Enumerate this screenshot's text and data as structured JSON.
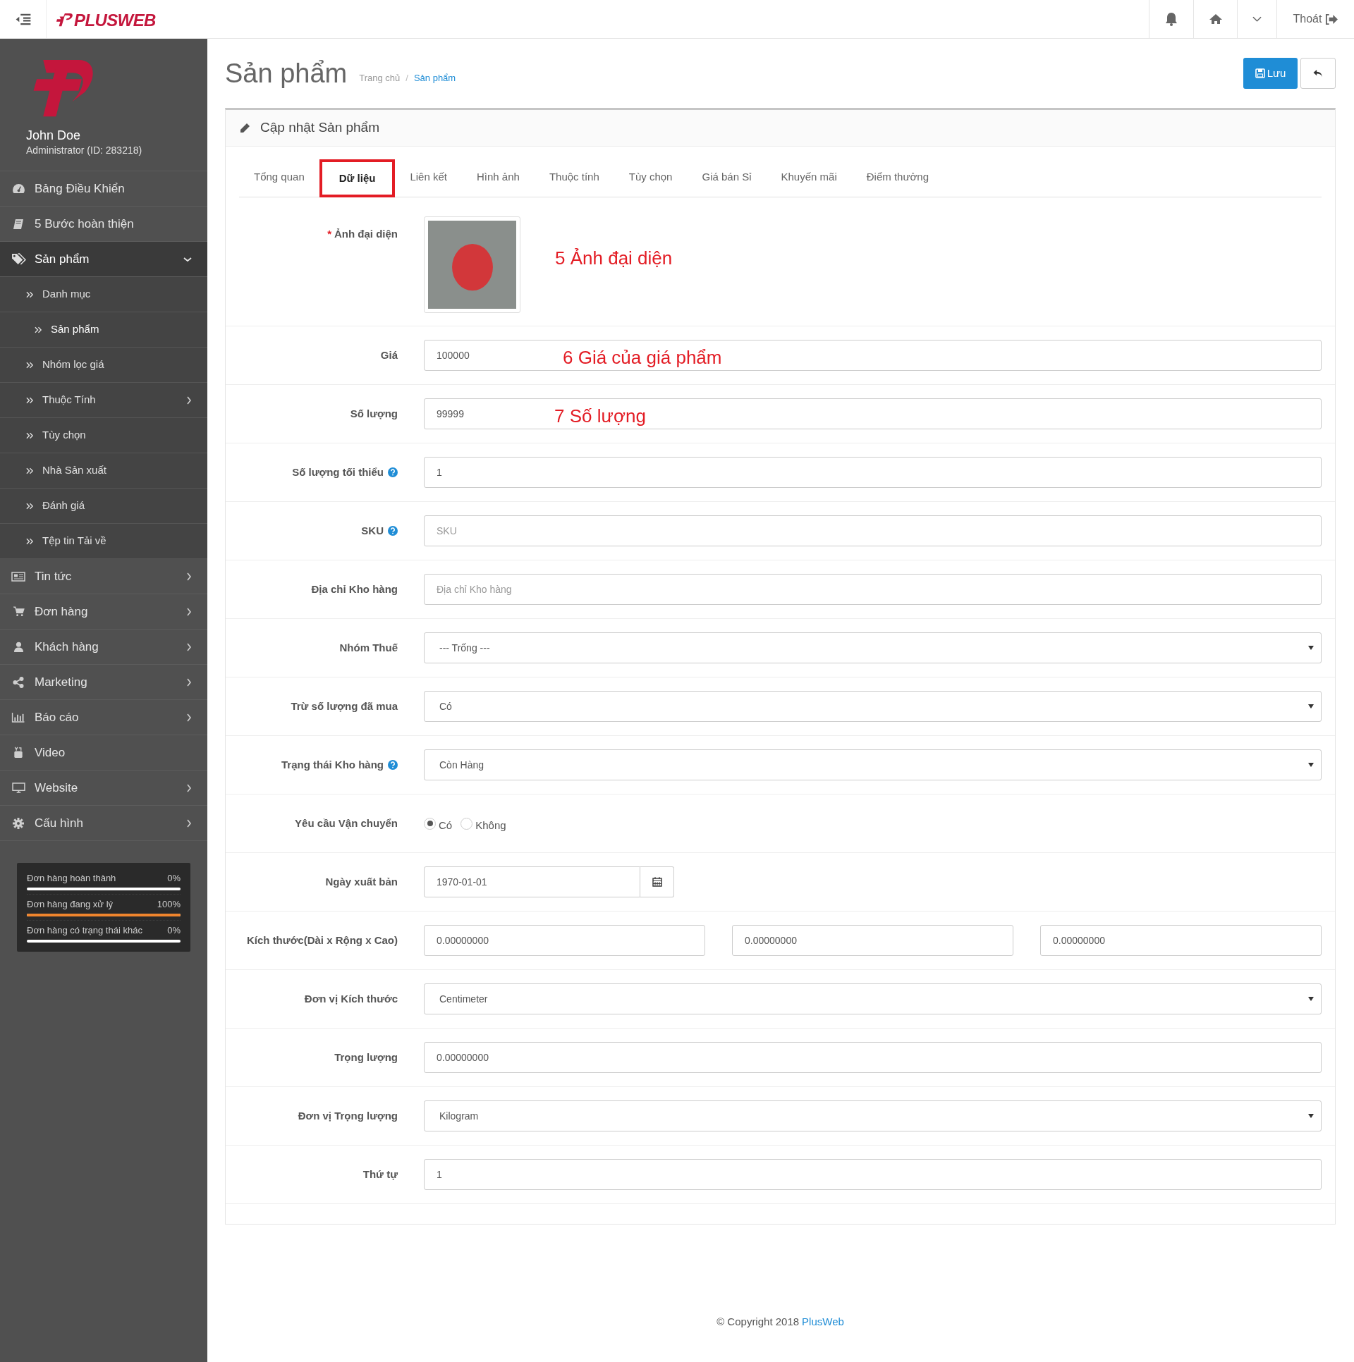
{
  "topbar": {
    "logo": "PLUSWEB",
    "logout": "Thoát"
  },
  "sidebar": {
    "user": {
      "name": "John Doe",
      "role": "Administrator (ID: 283218)"
    },
    "items": [
      {
        "label": "Bảng Điều Khiển",
        "has_arrow": false,
        "expanded": false
      },
      {
        "label": "5 Bước hoàn thiện",
        "has_arrow": false,
        "expanded": false
      },
      {
        "label": "Sản phẩm",
        "has_arrow": true,
        "expanded": true,
        "children": [
          {
            "label": "Danh mục",
            "has_arrow": false,
            "selected": false
          },
          {
            "label": "Sản phẩm",
            "has_arrow": false,
            "selected": true
          },
          {
            "label": "Nhóm lọc giá",
            "has_arrow": false,
            "selected": false
          },
          {
            "label": "Thuộc Tính",
            "has_arrow": true,
            "selected": false
          },
          {
            "label": "Tùy chọn",
            "has_arrow": false,
            "selected": false
          },
          {
            "label": "Nhà Sản xuất",
            "has_arrow": false,
            "selected": false
          },
          {
            "label": "Đánh giá",
            "has_arrow": false,
            "selected": false
          },
          {
            "label": "Tệp tin Tải về",
            "has_arrow": false,
            "selected": false
          }
        ]
      },
      {
        "label": "Tin tức",
        "has_arrow": true,
        "expanded": false
      },
      {
        "label": "Đơn hàng",
        "has_arrow": true,
        "expanded": false
      },
      {
        "label": "Khách hàng",
        "has_arrow": true,
        "expanded": false
      },
      {
        "label": "Marketing",
        "has_arrow": true,
        "expanded": false
      },
      {
        "label": "Báo cáo",
        "has_arrow": true,
        "expanded": false
      },
      {
        "label": "Video",
        "has_arrow": false,
        "expanded": false
      },
      {
        "label": "Website",
        "has_arrow": true,
        "expanded": false
      },
      {
        "label": "Cấu hình",
        "has_arrow": true,
        "expanded": false
      }
    ],
    "stats": [
      {
        "label": "Đơn hàng hoàn thành",
        "value": "0%",
        "level": 0
      },
      {
        "label": "Đơn hàng đang xử lý",
        "value": "100%",
        "level": 1
      },
      {
        "label": "Đơn hàng có trạng thái khác",
        "value": "0%",
        "level": 0
      }
    ]
  },
  "page": {
    "title": "Sản phẩm",
    "breadcrumb": [
      {
        "label": "Trang chủ",
        "kind": "plain"
      },
      {
        "label": "Sản phẩm",
        "kind": "link"
      }
    ],
    "breadcrumb_separator": "/",
    "save_button": "Lưu"
  },
  "panel": {
    "title": "Cập nhật Sản phẩm",
    "tabs": [
      {
        "label": "Tổng quan",
        "selected": false
      },
      {
        "label": "Dữ liệu",
        "selected": true
      },
      {
        "label": "Liên kết",
        "selected": false
      },
      {
        "label": "Hình ảnh",
        "selected": false
      },
      {
        "label": "Thuộc tính",
        "selected": false
      },
      {
        "label": "Tùy chọn",
        "selected": false
      },
      {
        "label": "Giá bán Sỉ",
        "selected": false
      },
      {
        "label": "Khuyến mãi",
        "selected": false
      },
      {
        "label": "Điểm thưởng",
        "selected": false
      }
    ],
    "fields": [
      {
        "kind": "image",
        "label": "Ảnh đại diện",
        "required_marker": "*",
        "help": false,
        "annotation": "5 Ảnh đại diện"
      },
      {
        "kind": "text",
        "label": "Giá",
        "help": false,
        "value": "100000",
        "annotation": "6 Giá của giá phẩm"
      },
      {
        "kind": "text",
        "label": "Số lượng",
        "help": false,
        "value": "99999",
        "annotation": "7 Số lượng"
      },
      {
        "kind": "text",
        "label": "Số lượng tối thiểu",
        "help": true,
        "value": "1"
      },
      {
        "kind": "text",
        "label": "SKU",
        "help": true,
        "placeholder": "SKU"
      },
      {
        "kind": "text",
        "label": "Địa chỉ Kho hàng",
        "help": false,
        "placeholder": "Địa chỉ Kho hàng"
      },
      {
        "kind": "select",
        "label": "Nhóm Thuế",
        "help": false,
        "value": "--- Trống ---"
      },
      {
        "kind": "select",
        "label": "Trừ số lượng đã mua",
        "help": false,
        "value": "Có"
      },
      {
        "kind": "select",
        "label": "Trạng thái Kho hàng",
        "help": true,
        "value": "Còn Hàng"
      },
      {
        "kind": "radio",
        "label": "Yêu cầu Vận chuyển",
        "help": false,
        "options": [
          {
            "label": "Có",
            "selected": true
          },
          {
            "label": "Không",
            "selected": false
          }
        ]
      },
      {
        "kind": "date",
        "label": "Ngày xuất bản",
        "help": false,
        "value": "1970-01-01"
      },
      {
        "kind": "triple",
        "label": "Kích thước(Dài x Rộng x Cao)",
        "help": false,
        "values": [
          "0.00000000",
          "0.00000000",
          "0.00000000"
        ]
      },
      {
        "kind": "select",
        "label": "Đơn vị Kích thước",
        "help": false,
        "value": "Centimeter"
      },
      {
        "kind": "text",
        "label": "Trọng lượng",
        "help": false,
        "value": "0.00000000"
      },
      {
        "kind": "select",
        "label": "Đơn vị Trọng lượng",
        "help": false,
        "value": "Kilogram"
      },
      {
        "kind": "text",
        "label": "Thứ tự",
        "help": false,
        "value": "1"
      }
    ]
  },
  "footer": {
    "text": "© Copyright 2018",
    "link": "PlusWeb"
  }
}
